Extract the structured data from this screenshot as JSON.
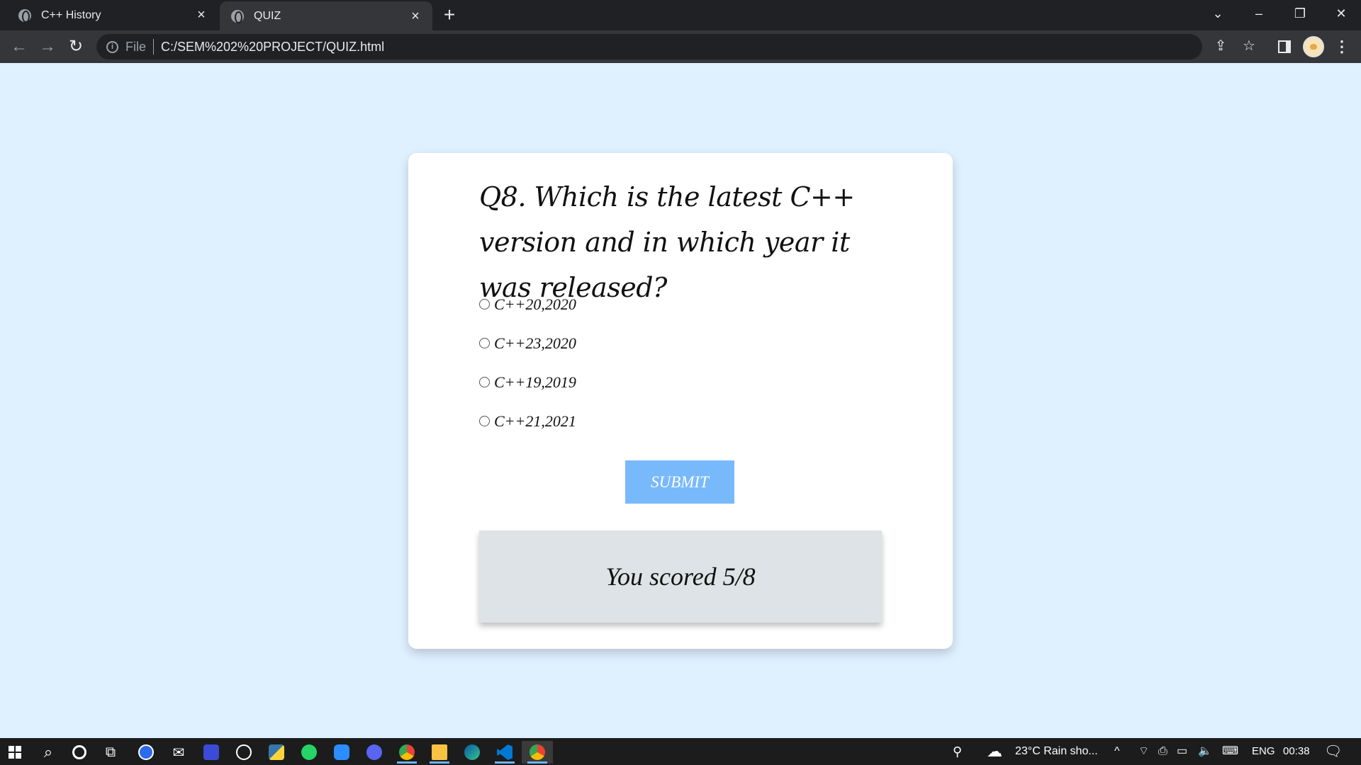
{
  "browser": {
    "tabs": [
      {
        "title": "C++ History",
        "active": false
      },
      {
        "title": "QUIZ",
        "active": true
      }
    ],
    "new_tab": "+",
    "address": {
      "scheme_label": "File",
      "url": "C:/SEM%202%20PROJECT/QUIZ.html"
    }
  },
  "quiz": {
    "question": "Q8. Which is the latest C++ version and in which year it was released?",
    "options": [
      "C++20,2020",
      "C++23,2020",
      "C++19,2019",
      "C++21,2021"
    ],
    "submit_label": "SUBMIT",
    "score_text": "You scored 5/8"
  },
  "colors": {
    "page_background": "#dff0ff",
    "submit_button": "#78b9fb",
    "score_box": "#dde3e6"
  },
  "taskbar": {
    "apps": [
      "windows-start",
      "search",
      "cortana",
      "task-view",
      "signal",
      "mail",
      "stylus-app",
      "xbox",
      "python",
      "whatsapp",
      "zoom",
      "discord",
      "chrome",
      "file-explorer",
      "edge",
      "vscode",
      "chrome-active"
    ],
    "weather": "23°C  Rain sho...",
    "language": "ENG",
    "time": "00:38"
  }
}
